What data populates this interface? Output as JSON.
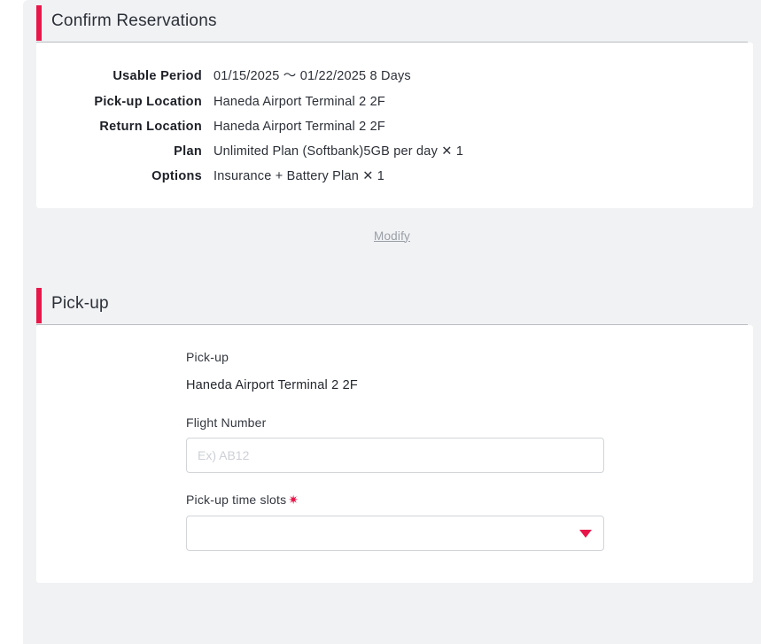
{
  "accent_color": "#e8174a",
  "confirm_section": {
    "title": "Confirm Reservations",
    "rows": [
      {
        "label": "Usable Period",
        "value": "01/15/2025 〜 01/22/2025  8 Days"
      },
      {
        "label": "Pick-up Location",
        "value": "Haneda Airport Terminal 2 2F"
      },
      {
        "label": "Return Location",
        "value": "Haneda Airport Terminal 2 2F"
      },
      {
        "label": "Plan",
        "value": "Unlimited Plan (Softbank)5GB per day ✕ 1"
      },
      {
        "label": "Options",
        "value": "Insurance + Battery Plan ✕ 1"
      }
    ],
    "modify_label": "Modify"
  },
  "pickup_section": {
    "title": "Pick-up",
    "sub_label": "Pick-up",
    "location": "Haneda Airport Terminal 2 2F",
    "flight_number": {
      "label": "Flight Number",
      "value": "",
      "placeholder": "Ex) AB12"
    },
    "time_slots": {
      "label": "Pick-up time slots",
      "required_mark": "✷",
      "selected": "",
      "options": [
        ""
      ]
    }
  }
}
